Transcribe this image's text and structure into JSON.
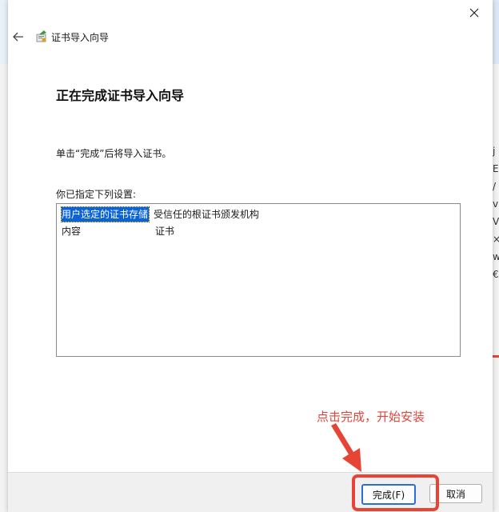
{
  "window": {
    "title": "证书导入向导",
    "close_label": "close"
  },
  "page": {
    "heading": "正在完成证书导入向导",
    "instruction": "单击“完成”后将导入证书。",
    "settings_label": "你已指定下列设置:",
    "settings": [
      {
        "key": "用户选定的证书存储",
        "value": "受信任的根证书颁发机构",
        "selected": true
      },
      {
        "key": "内容",
        "value": "证书",
        "selected": false
      }
    ]
  },
  "annotation": {
    "text": "点击完成，开始安装",
    "color": "#e0453a"
  },
  "buttons": {
    "finish": "完成(F)",
    "cancel": "取消"
  },
  "background_text": "j\nE\n/\nv\nV\n×\nw\n€",
  "colors": {
    "accent": "#0a64d6",
    "annotation_red": "#e64536"
  },
  "icons": {
    "back": "arrow-left-icon",
    "wizard": "certificate-wizard-icon",
    "close": "close-icon"
  }
}
